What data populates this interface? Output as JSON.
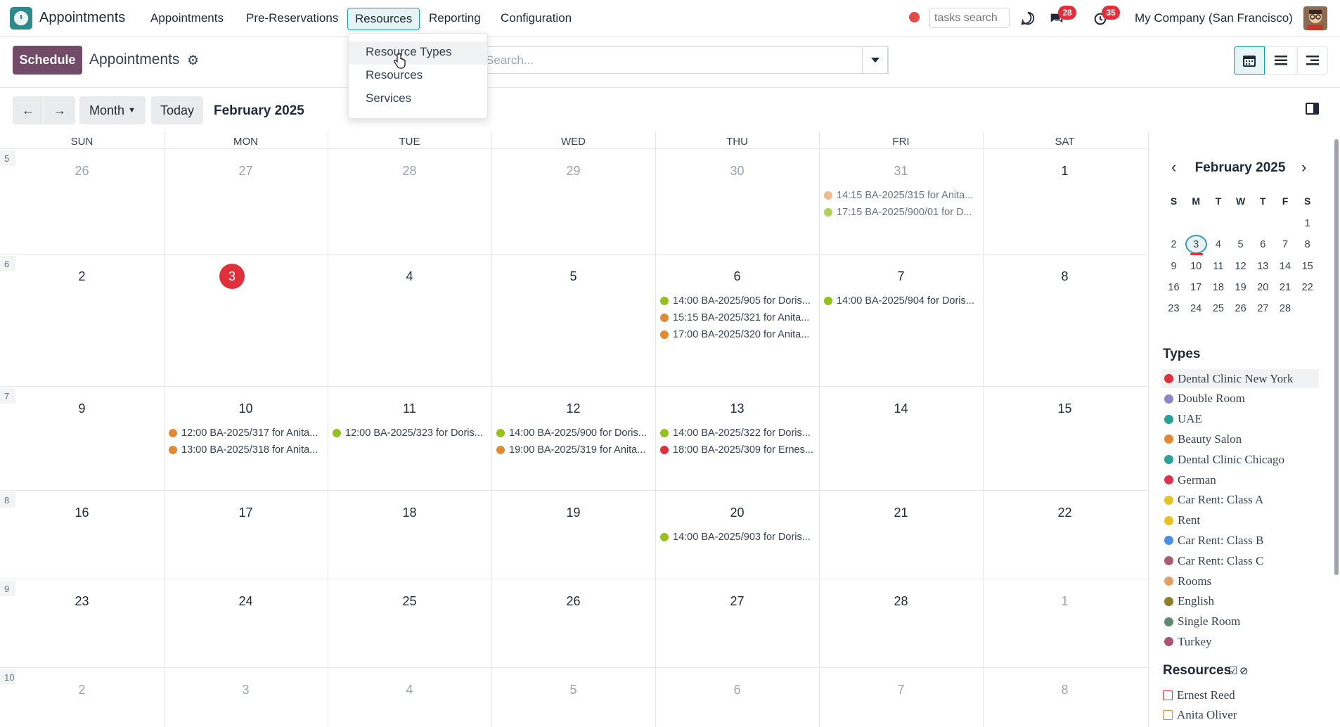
{
  "navbar": {
    "app_name": "Appointments",
    "menu": [
      "Appointments",
      "Pre-Reservations",
      "Resources",
      "Reporting",
      "Configuration"
    ],
    "tasks_search_placeholder": "tasks search",
    "messages_badge": "28",
    "activities_badge": "35",
    "company": "My Company (San Francisco)"
  },
  "dropdown": {
    "items": [
      "Resource Types",
      "Resources",
      "Services"
    ]
  },
  "control_panel": {
    "schedule_label": "Schedule",
    "breadcrumb": "Appointments",
    "search_placeholder": "Search..."
  },
  "calendar_nav": {
    "scale_label": "Month",
    "today_label": "Today",
    "period_label": "February 2025"
  },
  "calendar": {
    "weekdays": [
      "SUN",
      "MON",
      "TUE",
      "WED",
      "THU",
      "FRI",
      "SAT"
    ],
    "weeks": [
      {
        "num": "5",
        "days": [
          "26",
          "27",
          "28",
          "29",
          "30",
          "31",
          "1"
        ]
      },
      {
        "num": "6",
        "days": [
          "2",
          "3",
          "4",
          "5",
          "6",
          "7",
          "8"
        ]
      },
      {
        "num": "7",
        "days": [
          "9",
          "10",
          "11",
          "12",
          "13",
          "14",
          "15"
        ]
      },
      {
        "num": "8",
        "days": [
          "16",
          "17",
          "18",
          "19",
          "20",
          "21",
          "22"
        ]
      },
      {
        "num": "9",
        "days": [
          "23",
          "24",
          "25",
          "26",
          "27",
          "28",
          "1"
        ]
      },
      {
        "num": "10",
        "days": [
          "2",
          "3",
          "4",
          "5",
          "6",
          "7",
          "8"
        ]
      }
    ],
    "events": [
      {
        "week": 0,
        "day": 5,
        "slot": 0,
        "text": "14:15 BA-2025/315 for Anita...",
        "color": "#e8a36b"
      },
      {
        "week": 0,
        "day": 5,
        "slot": 1,
        "text": "17:15 BA-2025/900/01 for D...",
        "color": "#95c11f"
      },
      {
        "week": 1,
        "day": 4,
        "slot": 0,
        "text": "14:00 BA-2025/905 for Doris...",
        "color": "#95c11f"
      },
      {
        "week": 1,
        "day": 4,
        "slot": 1,
        "text": "15:15 BA-2025/321 for Anita...",
        "color": "#e08a38"
      },
      {
        "week": 1,
        "day": 4,
        "slot": 2,
        "text": "17:00 BA-2025/320 for Anita...",
        "color": "#e08a38"
      },
      {
        "week": 1,
        "day": 5,
        "slot": 0,
        "text": "14:00 BA-2025/904 for Doris...",
        "color": "#95c11f"
      },
      {
        "week": 2,
        "day": 1,
        "slot": 0,
        "text": "12:00 BA-2025/317 for Anita...",
        "color": "#e08a38"
      },
      {
        "week": 2,
        "day": 1,
        "slot": 1,
        "text": "13:00 BA-2025/318 for Anita...",
        "color": "#e08a38"
      },
      {
        "week": 2,
        "day": 2,
        "slot": 0,
        "text": "12:00 BA-2025/323 for Doris...",
        "color": "#95c11f"
      },
      {
        "week": 2,
        "day": 3,
        "slot": 0,
        "text": "14:00 BA-2025/900 for Doris...",
        "color": "#95c11f"
      },
      {
        "week": 2,
        "day": 3,
        "slot": 1,
        "text": "19:00 BA-2025/319 for Anita...",
        "color": "#e08a38"
      },
      {
        "week": 2,
        "day": 4,
        "slot": 0,
        "text": "14:00 BA-2025/322 for Doris...",
        "color": "#95c11f"
      },
      {
        "week": 2,
        "day": 4,
        "slot": 1,
        "text": "18:00 BA-2025/309 for Ernes...",
        "color": "#e0303b"
      },
      {
        "week": 3,
        "day": 4,
        "slot": 0,
        "text": "14:00 BA-2025/903 for Doris...",
        "color": "#95c11f"
      }
    ]
  },
  "mini_calendar": {
    "title": "February 2025",
    "weekdays": [
      "S",
      "M",
      "T",
      "W",
      "T",
      "F",
      "S"
    ],
    "rows": [
      [
        "",
        "",
        "",
        "",
        "",
        "",
        "1"
      ],
      [
        "2",
        "3",
        "4",
        "5",
        "6",
        "7",
        "8"
      ],
      [
        "9",
        "10",
        "11",
        "12",
        "13",
        "14",
        "15"
      ],
      [
        "16",
        "17",
        "18",
        "19",
        "20",
        "21",
        "22"
      ],
      [
        "23",
        "24",
        "25",
        "26",
        "27",
        "28",
        ""
      ]
    ]
  },
  "types": {
    "title": "Types",
    "items": [
      {
        "label": "Dental Clinic New York",
        "color": "#e0303b"
      },
      {
        "label": "Double Room",
        "color": "#8e84c6"
      },
      {
        "label": "UAE",
        "color": "#2aa198"
      },
      {
        "label": "Beauty Salon",
        "color": "#e08a38"
      },
      {
        "label": "Dental Clinic Chicago",
        "color": "#2aa198"
      },
      {
        "label": "German",
        "color": "#e0304f"
      },
      {
        "label": "Car Rent: Class A",
        "color": "#e6c229"
      },
      {
        "label": "Rent",
        "color": "#e6c229"
      },
      {
        "label": "Car Rent: Class B",
        "color": "#4a90e2"
      },
      {
        "label": "Car Rent: Class C",
        "color": "#a85d6e"
      },
      {
        "label": "Rooms",
        "color": "#e0a06b"
      },
      {
        "label": "English",
        "color": "#8b7f2a"
      },
      {
        "label": "Single Room",
        "color": "#5e8a6e"
      },
      {
        "label": "Turkey",
        "color": "#a8566e"
      }
    ]
  },
  "resources": {
    "title": "Resources",
    "items": [
      {
        "label": "Ernest Reed",
        "color": "#e0303b"
      },
      {
        "label": "Anita Oliver",
        "color": "#e08a38"
      }
    ]
  }
}
